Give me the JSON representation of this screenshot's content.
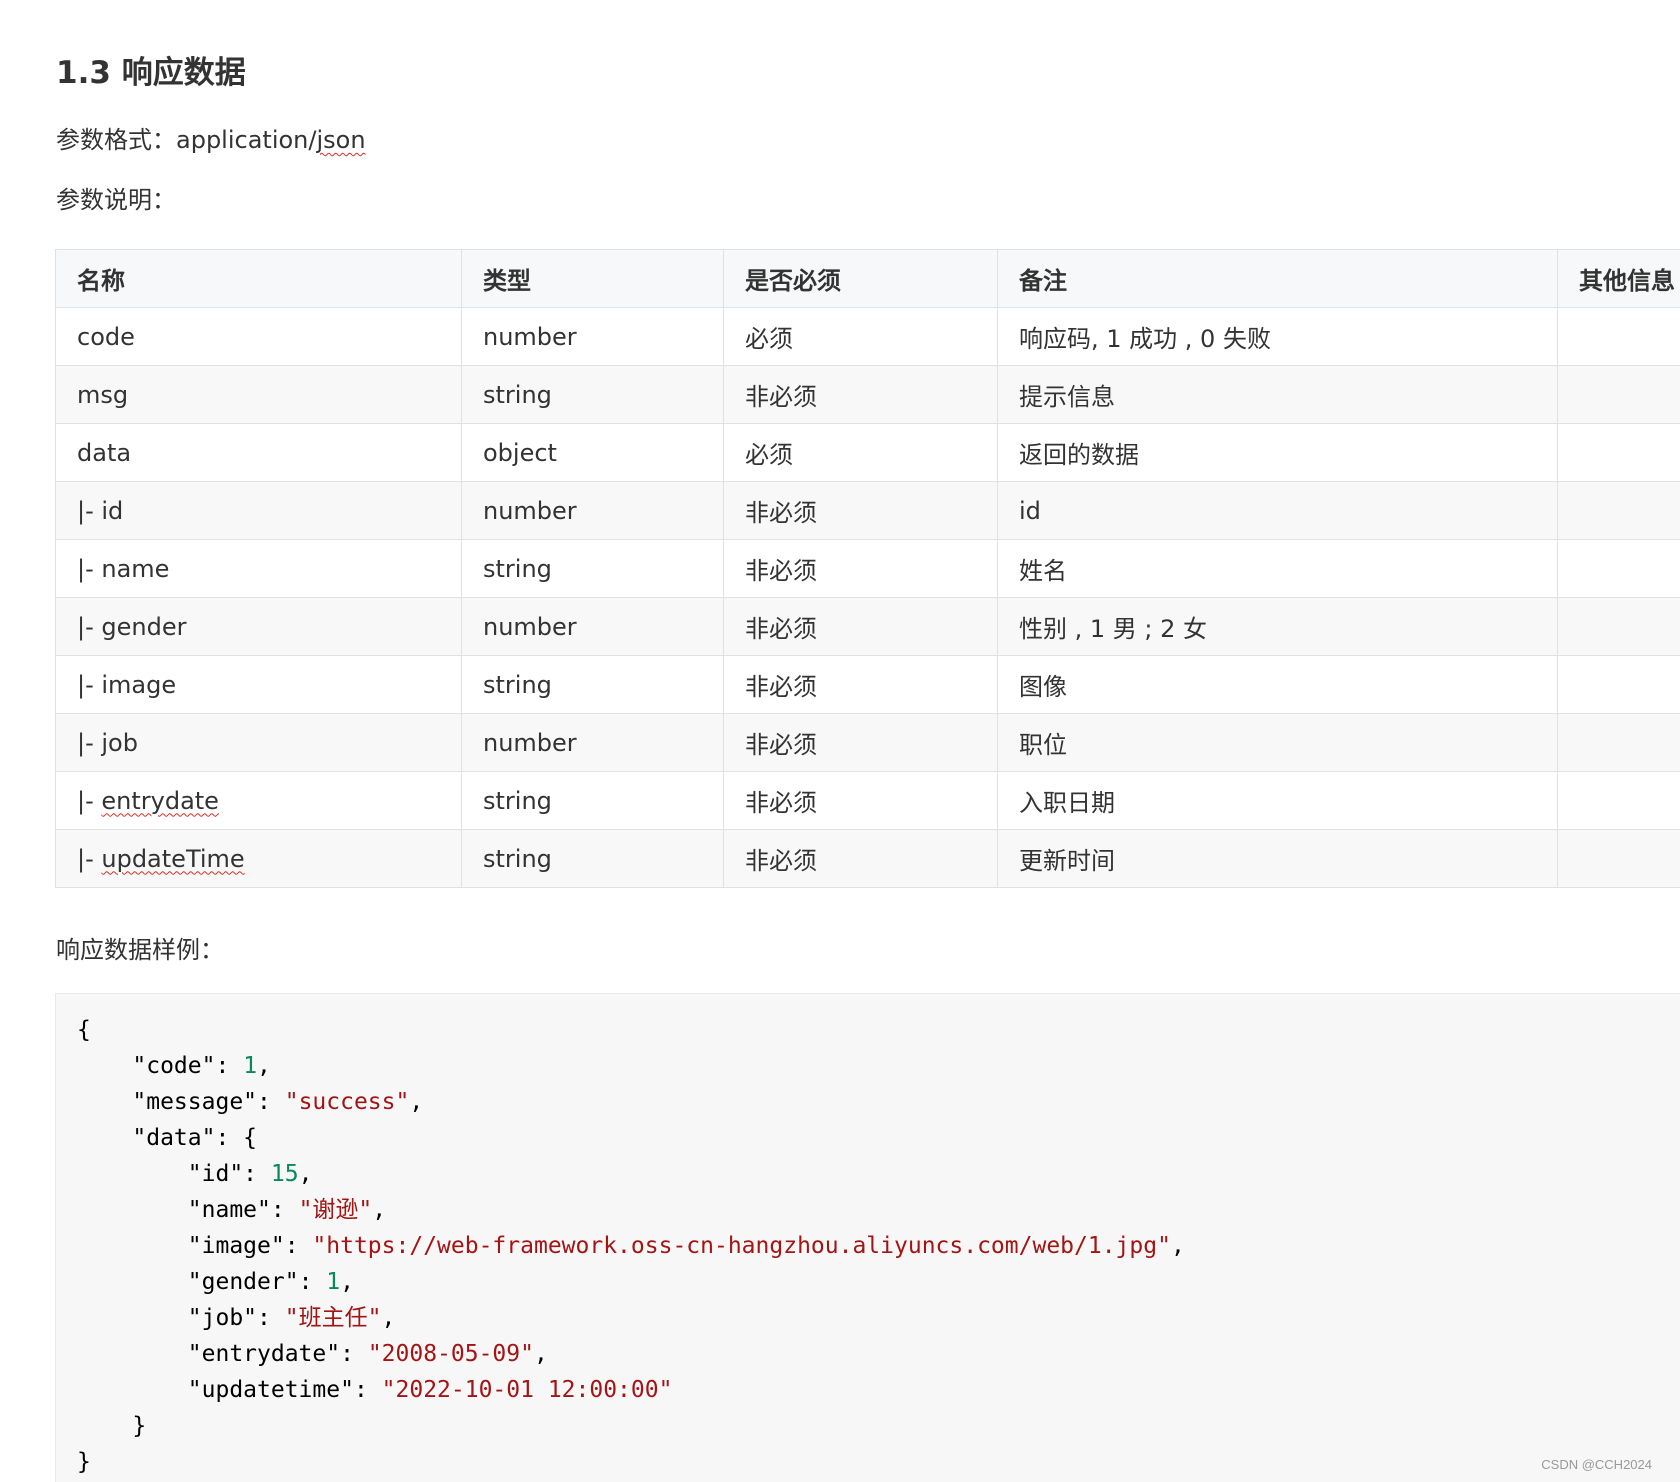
{
  "heading": "1.3 响应数据",
  "format": {
    "label": "参数格式：",
    "value_prefix": "application/",
    "value_flagged": "json"
  },
  "description_label": "参数说明：",
  "table": {
    "headers": [
      "名称",
      "类型",
      "是否必须",
      "备注",
      "其他信息"
    ],
    "rows": [
      {
        "name": "code",
        "type": "number",
        "required": "必须",
        "note": "响应码, 1 成功 , 0 失败",
        "other": ""
      },
      {
        "name": "msg",
        "type": "string",
        "required": "非必须",
        "note": "提示信息",
        "other": ""
      },
      {
        "name": "data",
        "type": "object",
        "required": "必须",
        "note": "返回的数据",
        "other": ""
      },
      {
        "name": "|- id",
        "type": "number",
        "required": "非必须",
        "note": "id",
        "other": ""
      },
      {
        "name": "|- name",
        "type": "string",
        "required": "非必须",
        "note": "姓名",
        "other": ""
      },
      {
        "name": "|- gender",
        "type": "number",
        "required": "非必须",
        "note": "性别 , 1 男 ; 2 女",
        "other": ""
      },
      {
        "name": "|- image",
        "type": "string",
        "required": "非必须",
        "note": "图像",
        "other": ""
      },
      {
        "name": "|- job",
        "type": "number",
        "required": "非必须",
        "note": "职位",
        "other": ""
      },
      {
        "name": "|- entrydate",
        "type": "string",
        "required": "非必须",
        "note": "入职日期",
        "other": ""
      },
      {
        "name": "|- updateTime",
        "type": "string",
        "required": "非必须",
        "note": "更新时间",
        "other": ""
      }
    ]
  },
  "sample_label": "响应数据样例：",
  "code_sample": [
    [
      {
        "t": "p",
        "v": "{"
      }
    ],
    [
      {
        "t": "p",
        "v": "    "
      },
      {
        "t": "k",
        "v": "\"code\""
      },
      {
        "t": "p",
        "v": ": "
      },
      {
        "t": "n",
        "v": "1"
      },
      {
        "t": "p",
        "v": ","
      }
    ],
    [
      {
        "t": "p",
        "v": "    "
      },
      {
        "t": "k",
        "v": "\"message\""
      },
      {
        "t": "p",
        "v": ": "
      },
      {
        "t": "s",
        "v": "\"success\""
      },
      {
        "t": "p",
        "v": ","
      }
    ],
    [
      {
        "t": "p",
        "v": "    "
      },
      {
        "t": "k",
        "v": "\"data\""
      },
      {
        "t": "p",
        "v": ": {"
      }
    ],
    [
      {
        "t": "p",
        "v": "        "
      },
      {
        "t": "k",
        "v": "\"id\""
      },
      {
        "t": "p",
        "v": ": "
      },
      {
        "t": "n",
        "v": "15"
      },
      {
        "t": "p",
        "v": ","
      }
    ],
    [
      {
        "t": "p",
        "v": "        "
      },
      {
        "t": "k",
        "v": "\"name\""
      },
      {
        "t": "p",
        "v": ": "
      },
      {
        "t": "s",
        "v": "\"谢逊\""
      },
      {
        "t": "p",
        "v": ","
      }
    ],
    [
      {
        "t": "p",
        "v": "        "
      },
      {
        "t": "k",
        "v": "\"image\""
      },
      {
        "t": "p",
        "v": ": "
      },
      {
        "t": "s",
        "v": "\"https://web-framework.oss-cn-hangzhou.aliyuncs.com/web/1.jpg\""
      },
      {
        "t": "p",
        "v": ","
      }
    ],
    [
      {
        "t": "p",
        "v": "        "
      },
      {
        "t": "k",
        "v": "\"gender\""
      },
      {
        "t": "p",
        "v": ": "
      },
      {
        "t": "n",
        "v": "1"
      },
      {
        "t": "p",
        "v": ","
      }
    ],
    [
      {
        "t": "p",
        "v": "        "
      },
      {
        "t": "k",
        "v": "\"job\""
      },
      {
        "t": "p",
        "v": ": "
      },
      {
        "t": "s",
        "v": "\"班主任\""
      },
      {
        "t": "p",
        "v": ","
      }
    ],
    [
      {
        "t": "p",
        "v": "        "
      },
      {
        "t": "k",
        "v": "\"entrydate\""
      },
      {
        "t": "p",
        "v": ": "
      },
      {
        "t": "s",
        "v": "\"2008-05-09\""
      },
      {
        "t": "p",
        "v": ","
      }
    ],
    [
      {
        "t": "p",
        "v": "        "
      },
      {
        "t": "k",
        "v": "\"updatetime\""
      },
      {
        "t": "p",
        "v": ": "
      },
      {
        "t": "s",
        "v": "\"2022-10-01 12:00:00\""
      }
    ],
    [
      {
        "t": "p",
        "v": "    }"
      }
    ],
    [
      {
        "t": "p",
        "v": "}"
      }
    ]
  ],
  "watermark": "CSDN @CCH2024",
  "colors": {
    "string": "#a31515",
    "number": "#09885a",
    "table_border": "#dfe2e5",
    "header_bg": "#f6f8fa",
    "code_bg": "#f7f7f7",
    "spellcheck": "#d93025"
  }
}
